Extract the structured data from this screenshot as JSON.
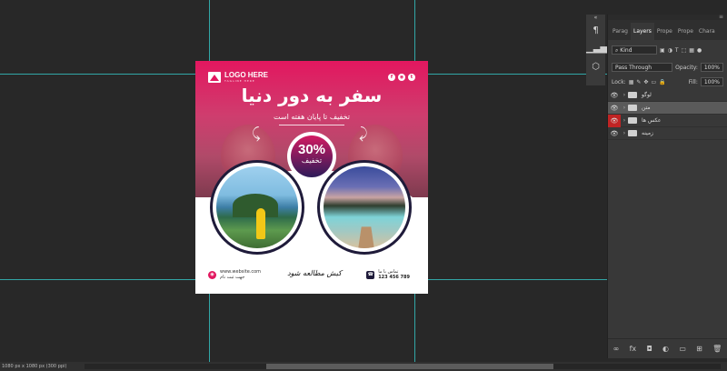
{
  "artboard": {
    "logo": {
      "text": "LOGO HERE",
      "sub": "TAGLINE HERE"
    },
    "socials": [
      "f",
      "◉",
      "t"
    ],
    "headline": "سفر به دور دنیا",
    "subline": "تخفیف تا پایان هفته است",
    "discount": {
      "value": "30%",
      "label": "تخفیف"
    },
    "footer": {
      "website": "www.website.com",
      "signup": "جهت ثبت نام",
      "tagline": "کیش مطالعه شود",
      "phone_label": "تماس با ما",
      "phone": "123 456 789"
    }
  },
  "panel": {
    "tabs": [
      "Parag",
      "Layers",
      "Prope",
      "Prope",
      "Chara"
    ],
    "kind_label": "Kind",
    "blend_mode": "Pass Through",
    "opacity_label": "Opacity:",
    "opacity_value": "100%",
    "lock_label": "Lock:",
    "fill_label": "Fill:",
    "fill_value": "100%",
    "layers": [
      {
        "name": "لوگو"
      },
      {
        "name": "متن"
      },
      {
        "name": "عکس ها"
      },
      {
        "name": "زمینه"
      }
    ],
    "bottom_icons": [
      "∞",
      "fx",
      "◘",
      "◐",
      "▭",
      "⊞",
      "🗑"
    ]
  },
  "status": {
    "text": "1080 px x 1080 px (300 ppi)"
  }
}
